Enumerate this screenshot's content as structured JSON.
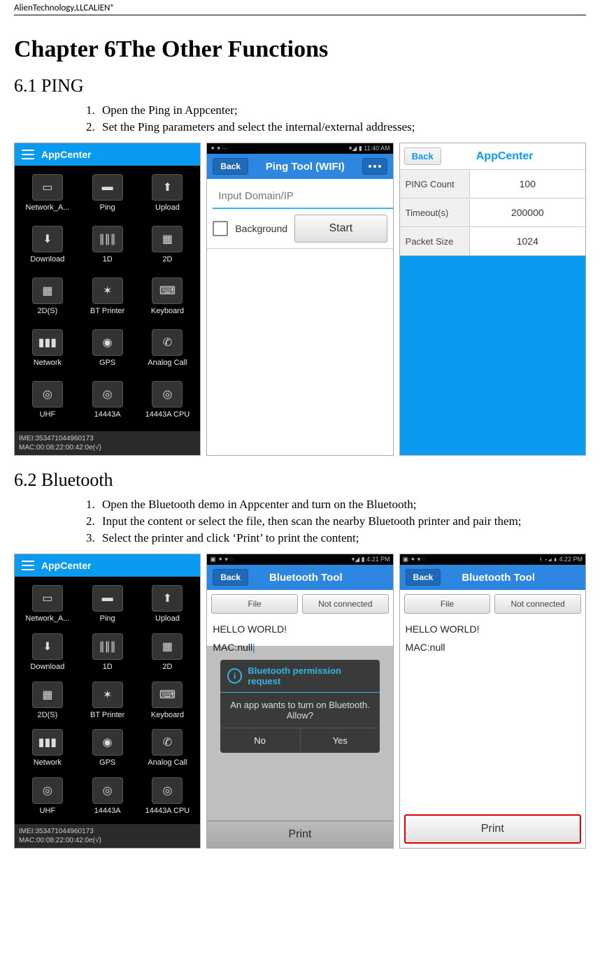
{
  "header": {
    "text": "AlienTechnology,LLCALIEN®"
  },
  "chapter": {
    "title": "Chapter 6The Other Functions"
  },
  "section61": {
    "title": "6.1 PING",
    "steps": [
      "Open the Ping in Appcenter;",
      "Set the Ping parameters and select the internal/external addresses;"
    ]
  },
  "section62": {
    "title": "6.2   Bluetooth",
    "steps": [
      "Open the Bluetooth demo in Appcenter and turn on the Bluetooth;",
      "Input the content or select the file, then scan the nearby Bluetooth printer and pair them;",
      "Select the printer and click ‘Print’ to print the content;"
    ]
  },
  "appcenter": {
    "title": "AppCenter",
    "items": [
      {
        "label": "Network_A...",
        "glyph": "▭"
      },
      {
        "label": "Ping",
        "glyph": "▬"
      },
      {
        "label": "Upload",
        "glyph": "⬆"
      },
      {
        "label": "Download",
        "glyph": "⬇"
      },
      {
        "label": "1D",
        "glyph": "∥∥∥"
      },
      {
        "label": "2D",
        "glyph": "▦"
      },
      {
        "label": "2D(S)",
        "glyph": "▦"
      },
      {
        "label": "BT Printer",
        "glyph": "✶"
      },
      {
        "label": "Keyboard",
        "glyph": "⌨"
      },
      {
        "label": "Network",
        "glyph": "▮▮▮"
      },
      {
        "label": "GPS",
        "glyph": "◉"
      },
      {
        "label": "Analog Call",
        "glyph": "✆"
      },
      {
        "label": "UHF",
        "glyph": "◎"
      },
      {
        "label": "14443A",
        "glyph": "◎"
      },
      {
        "label": "14443A CPU",
        "glyph": "◎"
      }
    ],
    "footer_line1": "IMEI:353471044960173",
    "footer_line2": "MAC:00:08:22:00:42:0e(√)"
  },
  "pingtool": {
    "status_left": "✦ ▾ ⋯",
    "status_right": "▾◢ ▮ 11:40 AM",
    "back": "Back",
    "title": "Ping Tool (WIFI)",
    "placeholder": "Input Domain/IP",
    "bg_label": "Background",
    "start": "Start"
  },
  "pingsettings": {
    "back": "Back",
    "title": "AppCenter",
    "rows": [
      {
        "k": "PING Count",
        "v": "100"
      },
      {
        "k": "Timeout(s)",
        "v": "200000"
      },
      {
        "k": "Packet Size",
        "v": "1024"
      }
    ]
  },
  "bttool_a": {
    "status_left": "▣ ✦ ▾ ◌",
    "status_right": "▾◢ ▮ 4:21 PM",
    "back": "Back",
    "title": "Bluetooth Tool",
    "file": "File",
    "conn": "Not connected",
    "line1": "HELLO WORLD!",
    "line2": "MAC:null",
    "dialog_title": "Bluetooth permission request",
    "dialog_msg": "An app wants to turn on Bluetooth. Allow?",
    "no": "No",
    "yes": "Yes",
    "print": "Print"
  },
  "bttool_b": {
    "status_left": "▣ ✦ ▾ ◌",
    "status_right": "ᚼ ▾◢ ▮ 4:22 PM",
    "back": "Back",
    "title": "Bluetooth Tool",
    "file": "File",
    "conn": "Not connected",
    "line1": "HELLO WORLD!",
    "line2": "MAC:null",
    "print": "Print"
  }
}
